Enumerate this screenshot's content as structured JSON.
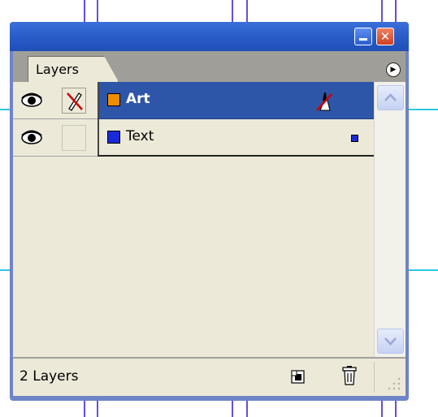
{
  "panel": {
    "tab_label": "Layers",
    "status": "2 Layers"
  },
  "layers": [
    {
      "name": "Art",
      "color": "#f08c00",
      "visible": true,
      "locked": false,
      "selected": true
    },
    {
      "name": "Text",
      "color": "#1a2ad8",
      "visible": true,
      "locked": false,
      "selected": false
    }
  ],
  "colors": {
    "selection": "#2e56a8",
    "panel_bg": "#ece9d8",
    "titlebar": "#2a5cc8",
    "guide_vertical": "#6a4be0",
    "guide_horizontal": "#2ec8e0"
  }
}
